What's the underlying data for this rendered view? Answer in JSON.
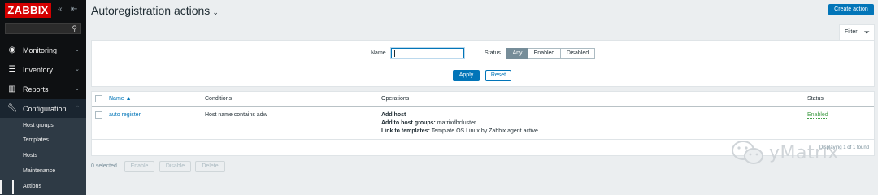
{
  "brand": "ZABBIX",
  "sidebar": {
    "collapse_icon": "«",
    "kiosk_icon": "⇤",
    "items": [
      {
        "label": "Monitoring",
        "icon": "eye-icon"
      },
      {
        "label": "Inventory",
        "icon": "list-icon"
      },
      {
        "label": "Reports",
        "icon": "bar-chart-icon"
      },
      {
        "label": "Configuration",
        "icon": "wrench-icon"
      }
    ],
    "sub_items": [
      "Host groups",
      "Templates",
      "Hosts",
      "Maintenance",
      "Actions"
    ]
  },
  "header": {
    "title": "Autoregistration actions",
    "create_button": "Create action"
  },
  "filter": {
    "tab_label": "Filter",
    "name_label": "Name",
    "name_value": "",
    "status_label": "Status",
    "status_options": [
      "Any",
      "Enabled",
      "Disabled"
    ],
    "status_selected": "Any",
    "apply": "Apply",
    "reset": "Reset"
  },
  "table": {
    "columns": [
      "Name ▲",
      "Conditions",
      "Operations",
      "Status"
    ],
    "rows": [
      {
        "name": "auto register",
        "conditions": "Host name contains adw",
        "op1": "Add host",
        "op2_label": "Add to host groups:",
        "op2_value": "matrixdbcluster",
        "op3_label": "Link to templates:",
        "op3_value": "Template OS Linux by Zabbix agent active",
        "status": "Enabled"
      }
    ],
    "count_text": "Displaying 1 of 1 found"
  },
  "footer": {
    "selected": "0 selected",
    "buttons": [
      "Enable",
      "Disable",
      "Delete"
    ]
  },
  "watermark": "yMatrix",
  "colors": {
    "brand_red": "#d40000",
    "primary_blue": "#0275b8",
    "enabled_green": "#429e47",
    "sidebar_bg": "#0e1012"
  }
}
